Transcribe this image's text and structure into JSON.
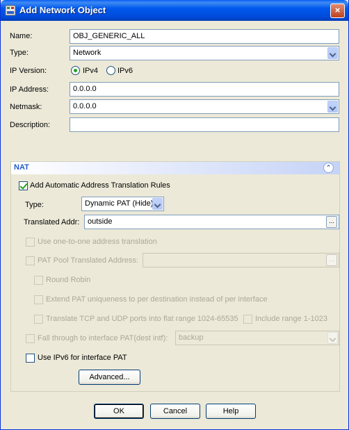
{
  "window": {
    "title": "Add Network Object",
    "close_glyph": "×"
  },
  "form": {
    "name_label": "Name:",
    "name_value": "OBJ_GENERIC_ALL",
    "type_label": "Type:",
    "type_value": "Network",
    "ipversion_label": "IP Version:",
    "ipv4_label": "IPv4",
    "ipv6_label": "IPv6",
    "ipv4_selected": true,
    "ipaddress_label": "IP Address:",
    "ipaddress_value": "0.0.0.0",
    "netmask_label": "Netmask:",
    "netmask_value": "0.0.0.0",
    "description_label": "Description:",
    "description_value": ""
  },
  "nat": {
    "title": "NAT",
    "collapse_glyph": "⌃",
    "auto_rules_label": "Add Automatic Address Translation Rules",
    "auto_rules_checked": true,
    "type_label": "Type:",
    "type_value": "Dynamic PAT (Hide)",
    "translated_label": "Translated Addr:",
    "translated_value": "outside",
    "browse_glyph": "...",
    "one_to_one_label": "Use one-to-one address translation",
    "pat_pool_label": "PAT Pool Translated Address:",
    "pat_pool_value": "",
    "round_robin_label": "Round Robin",
    "extend_pat_label": "Extend PAT uniqueness to per destination instead of per interface",
    "translate_tcp_label": "Translate TCP and UDP ports into flat range 1024-65535",
    "include_range_label": "Include range 1-1023",
    "fall_through_label": "Fall through to interface PAT(dest intf):",
    "fall_through_value": "backup",
    "ipv6_pat_label": "Use IPv6 for interface PAT",
    "ipv6_pat_checked": false,
    "advanced_label": "Advanced..."
  },
  "buttons": {
    "ok": "OK",
    "cancel": "Cancel",
    "help": "Help"
  },
  "colors": {
    "titlebar": "#0058ee",
    "dialog_bg": "#ece9d8",
    "nat_title": "#215dc6",
    "check_mark": "#21a121"
  },
  "icons": {
    "window": "network-object-icon",
    "close": "close-icon"
  }
}
